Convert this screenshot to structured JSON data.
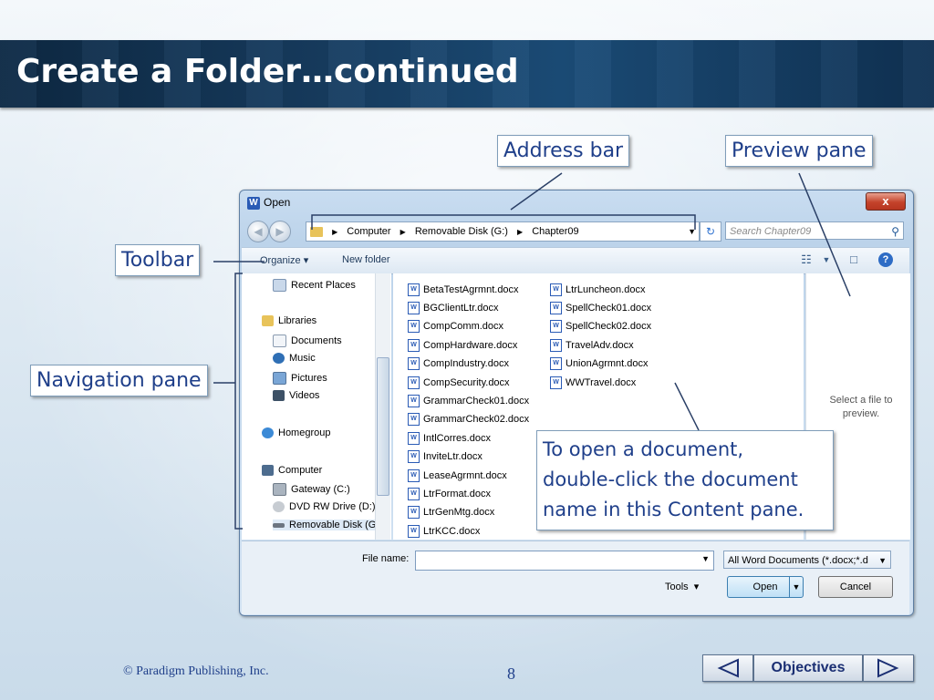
{
  "slide": {
    "title": "Create a Folder…continued",
    "footer_copyright": "© Paradigm Publishing, Inc.",
    "page_number": "8",
    "objectives_label": "Objectives"
  },
  "callouts": {
    "address_bar": "Address bar",
    "preview_pane": "Preview pane",
    "toolbar": "Toolbar",
    "navigation_pane": "Navigation pane",
    "content_note_line1": "To open a document,",
    "content_note_line2": "double-click the document",
    "content_note_line3": "name in this Content pane."
  },
  "dialog": {
    "title": "Open",
    "close_label": "x",
    "address": {
      "crumbs": [
        "Computer",
        "Removable Disk (G:)",
        "Chapter09"
      ]
    },
    "search_placeholder": "Search Chapter09",
    "toolbar": {
      "organize": "Organize ▾",
      "new_folder": "New folder"
    },
    "nav_items": [
      {
        "label": "Recent Places",
        "icon": "recent-places-icon"
      },
      {
        "label": "Libraries",
        "icon": "libraries-icon"
      },
      {
        "label": "Documents",
        "icon": "documents-icon"
      },
      {
        "label": "Music",
        "icon": "music-icon"
      },
      {
        "label": "Pictures",
        "icon": "pictures-icon"
      },
      {
        "label": "Videos",
        "icon": "videos-icon"
      },
      {
        "label": "Homegroup",
        "icon": "homegroup-icon"
      },
      {
        "label": "Computer",
        "icon": "computer-icon"
      },
      {
        "label": "Gateway (C:)",
        "icon": "drive-icon"
      },
      {
        "label": "DVD RW Drive (D:)",
        "icon": "dvd-icon"
      },
      {
        "label": "Removable Disk (G:",
        "icon": "removable-disk-icon"
      }
    ],
    "files_col1": [
      "BetaTestAgrmnt.docx",
      "BGClientLtr.docx",
      "CompComm.docx",
      "CompHardware.docx",
      "CompIndustry.docx",
      "CompSecurity.docx",
      "GrammarCheck01.docx",
      "GrammarCheck02.docx",
      "IntlCorres.docx",
      "InviteLtr.docx",
      "LeaseAgrmnt.docx",
      "LtrFormat.docx",
      "LtrGenMtg.docx",
      "LtrKCC.docx"
    ],
    "files_col2": [
      "LtrLuncheon.docx",
      "SpellCheck01.docx",
      "SpellCheck02.docx",
      "TravelAdv.docx",
      "UnionAgrmnt.docx",
      "WWTravel.docx"
    ],
    "preview_text": "Select a file to preview.",
    "file_name_label": "File name:",
    "file_name_value": "",
    "file_type": "All Word Documents (*.docx;*.d",
    "tools_label": "Tools",
    "open_label": "Open",
    "cancel_label": "Cancel"
  }
}
